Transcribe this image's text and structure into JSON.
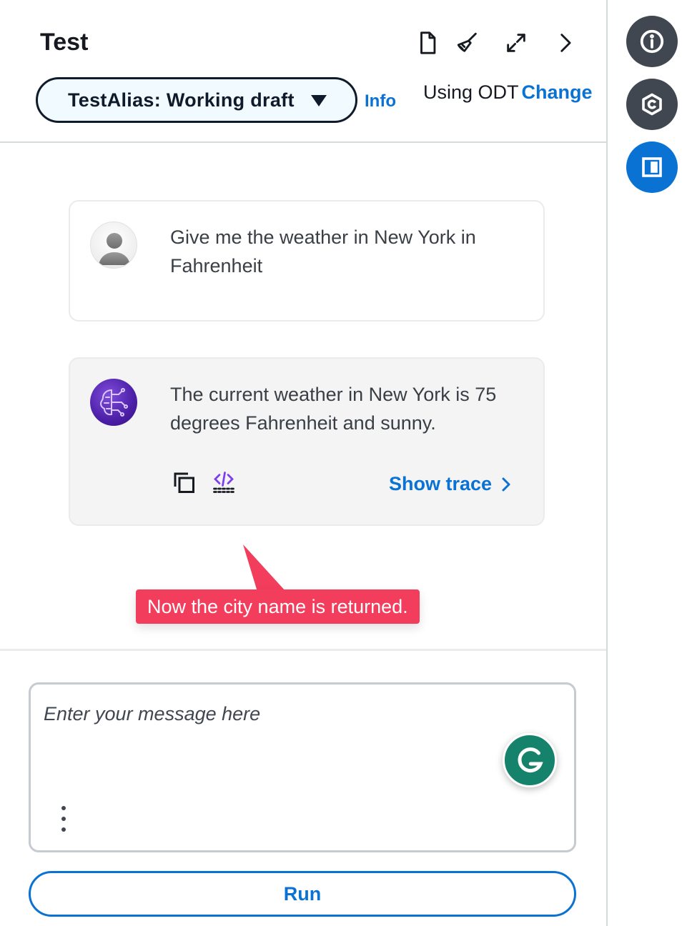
{
  "panel": {
    "title": "Test",
    "alias_select": {
      "value": "TestAlias: Working draft"
    },
    "info_link": "Info",
    "odt": {
      "label": "Using ODT",
      "change_link": "Change"
    },
    "header_icons": [
      "document-icon",
      "broom-icon",
      "expand-icon",
      "chevron-right-icon"
    ]
  },
  "chat": {
    "messages": [
      {
        "role": "user",
        "text": "Give me the weather in New York in Fahrenheit"
      },
      {
        "role": "assistant",
        "text": "The current weather in New York is 75 degrees Fahrenheit and sunny.",
        "trace_link": "Show trace"
      }
    ],
    "annotation": "Now the city name is returned."
  },
  "input": {
    "placeholder": "Enter your message here",
    "run_label": "Run"
  },
  "rail": [
    "info-icon",
    "hexagon-icon",
    "panel-icon"
  ],
  "colors": {
    "accent": "#0972d3",
    "annotation": "#f23d5c",
    "grammarly": "#15826b",
    "rail_dark": "#414750"
  }
}
